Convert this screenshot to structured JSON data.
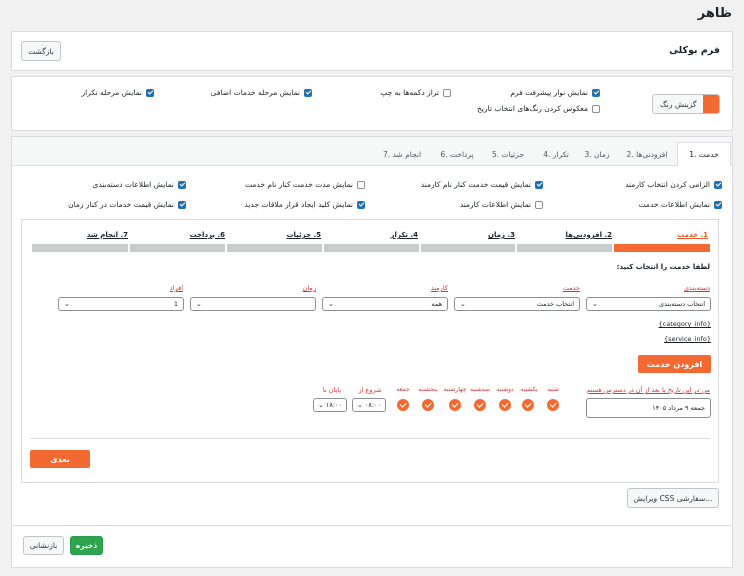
{
  "page": {
    "title": "ظاهر"
  },
  "form_card": {
    "title": "فرم بوکلی",
    "back_label": "بازگشت"
  },
  "options_card": {
    "color_picker_label": "گزینش رنگ",
    "accent_color": "#f26a32",
    "checkboxes": [
      {
        "label": "نمایش نوار پیشرفت فرم",
        "checked": true
      },
      {
        "label": "تراز دکمه‌ها به چپ",
        "checked": false
      },
      {
        "label": "نمایش مرحله خدمات اضافی",
        "checked": true
      },
      {
        "label": "نمایش مرحله تکرار",
        "checked": true
      },
      {
        "label": "معکوس کردن رنگ‌های انتخاب تاریخ",
        "checked": false
      }
    ]
  },
  "tabs": [
    {
      "label": "1. خدمت",
      "active": true
    },
    {
      "label": "2. افزودنی‌ها"
    },
    {
      "label": "3. زمان"
    },
    {
      "label": "4. تکرار"
    },
    {
      "label": "5. جزئیات"
    },
    {
      "label": "6. پرداخت"
    },
    {
      "label": "7. انجام شد"
    }
  ],
  "settings": [
    {
      "label": "الزامی کردن انتخاب کارمند",
      "checked": true
    },
    {
      "label": "نمایش قیمت خدمت کنار نام کارمند",
      "checked": true
    },
    {
      "label": "نمایش مدت خدمت کنار نام خدمت",
      "checked": false
    },
    {
      "label": "نمایش اطلاعات دسته‌بندی",
      "checked": true
    },
    {
      "label": "نمایش اطلاعات خدمت",
      "checked": true
    },
    {
      "label": "نمایش اطلاعات کارمند",
      "checked": false
    },
    {
      "label": "نمایش کلید ایجاد قرار ملاقات جدید",
      "checked": true
    },
    {
      "label": "نمایش قیمت خدمات در کنار زمان",
      "checked": true
    }
  ],
  "steps": [
    "1. خدمت",
    "2. افزودنی‌ها",
    "3. زمان",
    "4. تکرار",
    "5. جزئیات",
    "6. پرداخت",
    "7. انجام شد"
  ],
  "preview": {
    "prompt": "لطفا خدمت را انتخاب کنید:",
    "fields": {
      "category": {
        "label": "دسته‌بندی",
        "value": "انتخاب دسته‌بندی"
      },
      "service": {
        "label": "خدمت",
        "value": "انتخاب خدمت"
      },
      "staff": {
        "label": "کارمند",
        "value": "همه"
      },
      "time": {
        "label": "زمان",
        "value": ""
      },
      "persons": {
        "label": "افراد",
        "value": "1"
      }
    },
    "category_info": "{category_info}",
    "service_info": "{service_info}",
    "add_service_label": "افزودن خدمت",
    "date_label": "من در این تاریخ یا بعد از آن در دسترس هستم",
    "date_value": "جمعه ۹ مرداد ۱۴۰۵",
    "weekdays": [
      "شنبه",
      "یکشنبه",
      "دوشنبه",
      "سه‌شنبه",
      "چهارشنبه",
      "پنجشنبه",
      "جمعه"
    ],
    "start_label": "شروع از",
    "start_value": "۰۸:۰۰",
    "end_label": "پایان تا",
    "end_value": "۱۸:۰۰",
    "next_label": "بعدی"
  },
  "custom_css_label": "ویرایش CSS سفارشی...",
  "footer": {
    "save_label": "ذخیره",
    "reset_label": "بازنشانی"
  }
}
